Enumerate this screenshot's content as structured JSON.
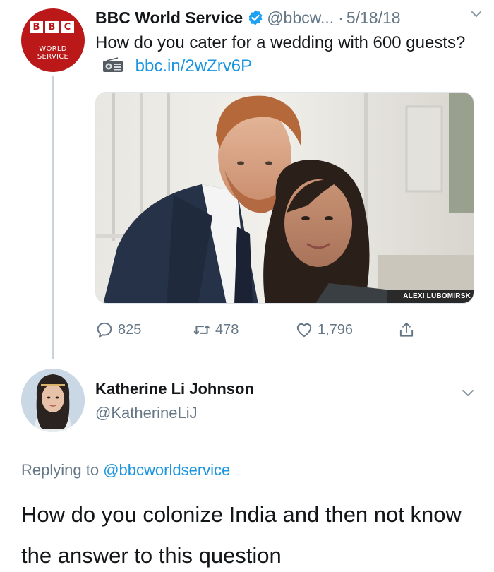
{
  "tweet": {
    "author": {
      "name": "BBC World Service",
      "handle": "@bbcw...",
      "verified": true,
      "avatar": {
        "logo_letters": [
          "B",
          "B",
          "C"
        ],
        "logo_line1": "WORLD",
        "logo_line2": "SERVICE"
      }
    },
    "separator": "·",
    "date": "5/18/18",
    "text": "How do you cater for a wedding with 600 guests?",
    "link": "bbc.in/2wZrv6P",
    "media": {
      "credit": "ALEXI LUBOMIRSK"
    },
    "stats": {
      "replies": "825",
      "retweets": "478",
      "likes": "1,796"
    }
  },
  "reply": {
    "author": {
      "name": "Katherine Li Johnson",
      "handle": "@KatherineLiJ"
    },
    "replying_prefix": "Replying to",
    "replying_to": "@bbcworldservice",
    "text": "How do you colonize India and then not know the answer to this question"
  },
  "colors": {
    "link": "#1b95e0",
    "muted": "#657786",
    "text": "#14171a",
    "bbc_red": "#bb1919",
    "thread_line": "#c9d3dc"
  }
}
